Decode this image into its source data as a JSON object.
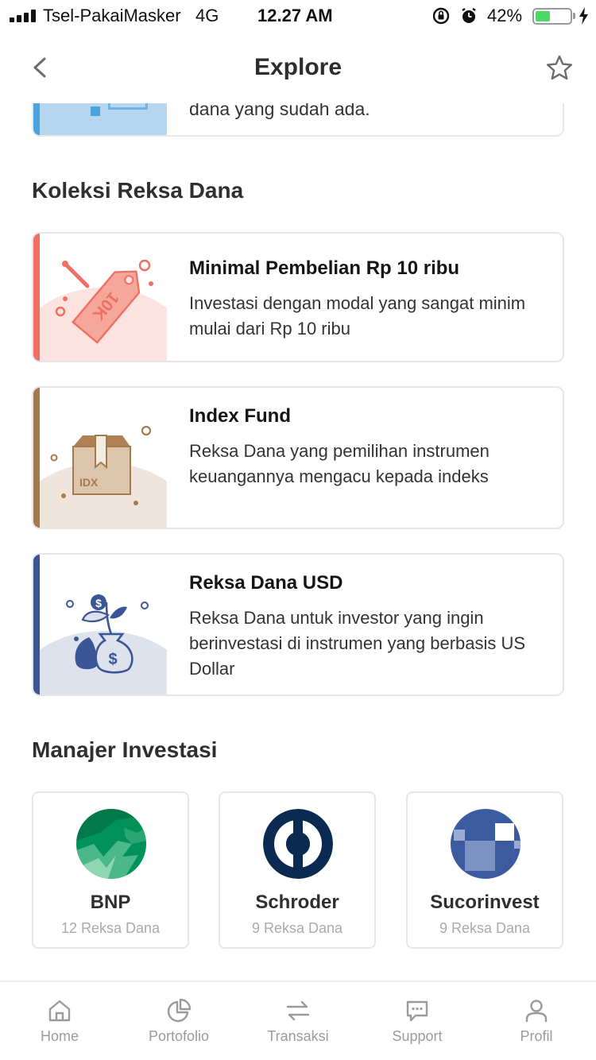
{
  "status_bar": {
    "carrier": "Tsel-PakaiMasker",
    "network": "4G",
    "time": "12.27 AM",
    "battery_percent": "42%",
    "battery_level": 0.42
  },
  "nav": {
    "title": "Explore"
  },
  "partial_card": {
    "description": "dana yang sudah ada.",
    "accent_color": "#4aa3df"
  },
  "collection": {
    "title": "Koleksi Reksa Dana",
    "cards": [
      {
        "title": "Minimal Pembelian Rp 10 ribu",
        "description": "Investasi dengan modal yang sangat minim mulai dari Rp 10 ribu",
        "icon": "price-tag-icon",
        "tag_text": "10K",
        "accent_color": "#ef6f62"
      },
      {
        "title": "Index Fund",
        "description": "Reksa Dana yang pemilihan instrumen keuangannya mengacu kepada indeks",
        "icon": "box-icon",
        "tag_text": "IDX",
        "accent_color": "#a47a4f"
      },
      {
        "title": "Reksa Dana USD",
        "description": "Reksa Dana untuk investor yang ingin berinvestasi di instrumen yang berbasis US Dollar",
        "icon": "money-bag-icon",
        "accent_color": "#3b5596"
      }
    ]
  },
  "managers": {
    "title": "Manajer Investasi",
    "items": [
      {
        "name": "BNP",
        "count": "12 Reksa Dana"
      },
      {
        "name": "Schroder",
        "count": "9 Reksa Dana"
      },
      {
        "name": "Sucorinvest",
        "count": "9 Reksa Dana"
      }
    ]
  },
  "tab_bar": {
    "items": [
      {
        "label": "Home",
        "icon": "home-icon"
      },
      {
        "label": "Portofolio",
        "icon": "pie-chart-icon"
      },
      {
        "label": "Transaksi",
        "icon": "swap-arrows-icon"
      },
      {
        "label": "Support",
        "icon": "chat-icon"
      },
      {
        "label": "Profil",
        "icon": "person-icon"
      }
    ]
  }
}
